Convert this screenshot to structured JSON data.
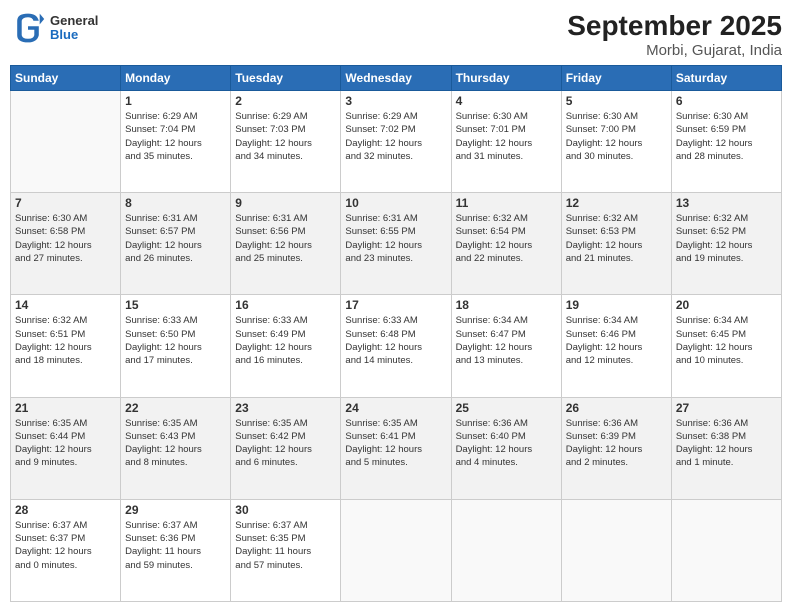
{
  "header": {
    "logo": {
      "general": "General",
      "blue": "Blue"
    },
    "title": "September 2025",
    "location": "Morbi, Gujarat, India"
  },
  "calendar": {
    "weekdays": [
      "Sunday",
      "Monday",
      "Tuesday",
      "Wednesday",
      "Thursday",
      "Friday",
      "Saturday"
    ],
    "rows": [
      [
        {
          "day": "",
          "info": ""
        },
        {
          "day": "1",
          "info": "Sunrise: 6:29 AM\nSunset: 7:04 PM\nDaylight: 12 hours\nand 35 minutes."
        },
        {
          "day": "2",
          "info": "Sunrise: 6:29 AM\nSunset: 7:03 PM\nDaylight: 12 hours\nand 34 minutes."
        },
        {
          "day": "3",
          "info": "Sunrise: 6:29 AM\nSunset: 7:02 PM\nDaylight: 12 hours\nand 32 minutes."
        },
        {
          "day": "4",
          "info": "Sunrise: 6:30 AM\nSunset: 7:01 PM\nDaylight: 12 hours\nand 31 minutes."
        },
        {
          "day": "5",
          "info": "Sunrise: 6:30 AM\nSunset: 7:00 PM\nDaylight: 12 hours\nand 30 minutes."
        },
        {
          "day": "6",
          "info": "Sunrise: 6:30 AM\nSunset: 6:59 PM\nDaylight: 12 hours\nand 28 minutes."
        }
      ],
      [
        {
          "day": "7",
          "info": "Sunrise: 6:30 AM\nSunset: 6:58 PM\nDaylight: 12 hours\nand 27 minutes."
        },
        {
          "day": "8",
          "info": "Sunrise: 6:31 AM\nSunset: 6:57 PM\nDaylight: 12 hours\nand 26 minutes."
        },
        {
          "day": "9",
          "info": "Sunrise: 6:31 AM\nSunset: 6:56 PM\nDaylight: 12 hours\nand 25 minutes."
        },
        {
          "day": "10",
          "info": "Sunrise: 6:31 AM\nSunset: 6:55 PM\nDaylight: 12 hours\nand 23 minutes."
        },
        {
          "day": "11",
          "info": "Sunrise: 6:32 AM\nSunset: 6:54 PM\nDaylight: 12 hours\nand 22 minutes."
        },
        {
          "day": "12",
          "info": "Sunrise: 6:32 AM\nSunset: 6:53 PM\nDaylight: 12 hours\nand 21 minutes."
        },
        {
          "day": "13",
          "info": "Sunrise: 6:32 AM\nSunset: 6:52 PM\nDaylight: 12 hours\nand 19 minutes."
        }
      ],
      [
        {
          "day": "14",
          "info": "Sunrise: 6:32 AM\nSunset: 6:51 PM\nDaylight: 12 hours\nand 18 minutes."
        },
        {
          "day": "15",
          "info": "Sunrise: 6:33 AM\nSunset: 6:50 PM\nDaylight: 12 hours\nand 17 minutes."
        },
        {
          "day": "16",
          "info": "Sunrise: 6:33 AM\nSunset: 6:49 PM\nDaylight: 12 hours\nand 16 minutes."
        },
        {
          "day": "17",
          "info": "Sunrise: 6:33 AM\nSunset: 6:48 PM\nDaylight: 12 hours\nand 14 minutes."
        },
        {
          "day": "18",
          "info": "Sunrise: 6:34 AM\nSunset: 6:47 PM\nDaylight: 12 hours\nand 13 minutes."
        },
        {
          "day": "19",
          "info": "Sunrise: 6:34 AM\nSunset: 6:46 PM\nDaylight: 12 hours\nand 12 minutes."
        },
        {
          "day": "20",
          "info": "Sunrise: 6:34 AM\nSunset: 6:45 PM\nDaylight: 12 hours\nand 10 minutes."
        }
      ],
      [
        {
          "day": "21",
          "info": "Sunrise: 6:35 AM\nSunset: 6:44 PM\nDaylight: 12 hours\nand 9 minutes."
        },
        {
          "day": "22",
          "info": "Sunrise: 6:35 AM\nSunset: 6:43 PM\nDaylight: 12 hours\nand 8 minutes."
        },
        {
          "day": "23",
          "info": "Sunrise: 6:35 AM\nSunset: 6:42 PM\nDaylight: 12 hours\nand 6 minutes."
        },
        {
          "day": "24",
          "info": "Sunrise: 6:35 AM\nSunset: 6:41 PM\nDaylight: 12 hours\nand 5 minutes."
        },
        {
          "day": "25",
          "info": "Sunrise: 6:36 AM\nSunset: 6:40 PM\nDaylight: 12 hours\nand 4 minutes."
        },
        {
          "day": "26",
          "info": "Sunrise: 6:36 AM\nSunset: 6:39 PM\nDaylight: 12 hours\nand 2 minutes."
        },
        {
          "day": "27",
          "info": "Sunrise: 6:36 AM\nSunset: 6:38 PM\nDaylight: 12 hours\nand 1 minute."
        }
      ],
      [
        {
          "day": "28",
          "info": "Sunrise: 6:37 AM\nSunset: 6:37 PM\nDaylight: 12 hours\nand 0 minutes."
        },
        {
          "day": "29",
          "info": "Sunrise: 6:37 AM\nSunset: 6:36 PM\nDaylight: 11 hours\nand 59 minutes."
        },
        {
          "day": "30",
          "info": "Sunrise: 6:37 AM\nSunset: 6:35 PM\nDaylight: 11 hours\nand 57 minutes."
        },
        {
          "day": "",
          "info": ""
        },
        {
          "day": "",
          "info": ""
        },
        {
          "day": "",
          "info": ""
        },
        {
          "day": "",
          "info": ""
        }
      ]
    ]
  }
}
